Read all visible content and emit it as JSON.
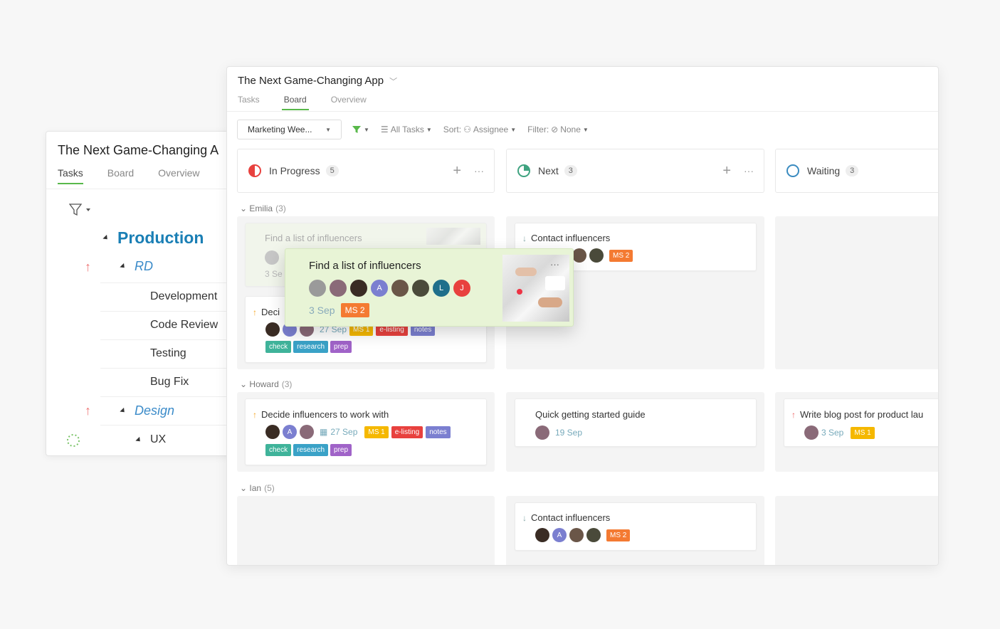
{
  "back": {
    "title": "The Next Game-Changing A",
    "tabs": [
      "Tasks",
      "Board",
      "Overview"
    ],
    "tree": {
      "production": "Production",
      "rd": "RD",
      "rd_items": [
        "Development",
        "Code Review",
        "Testing",
        "Bug Fix"
      ],
      "design": "Design",
      "ux": "UX"
    }
  },
  "front": {
    "title": "The Next Game-Changing App",
    "tabs": [
      "Tasks",
      "Board",
      "Overview"
    ],
    "toolbar": {
      "view": "Marketing Wee...",
      "all_tasks": "All Tasks",
      "sort_label": "Sort:",
      "sort_value": "Assignee",
      "filter_label": "Filter:",
      "filter_value": "None"
    },
    "columns": [
      {
        "name": "In Progress",
        "count": "5"
      },
      {
        "name": "Next",
        "count": "3"
      },
      {
        "name": "Waiting",
        "count": "3"
      }
    ],
    "lanes": [
      {
        "name": "Emilia",
        "count": "(3)"
      },
      {
        "name": "Howard",
        "count": "(3)"
      },
      {
        "name": "Ian",
        "count": "(5)"
      }
    ],
    "cards": {
      "ghost_title": "Find a list of influencers",
      "ghost_date": "3 Se",
      "decide_trunc_title": "Deci",
      "decide_trunc_date": "27 Sep",
      "contact_title": "Contact influencers",
      "contact_ms": "MS 2",
      "decide_title": "Decide influencers to work with",
      "decide_date": "27 Sep",
      "quick_title": "Quick getting started guide",
      "quick_date": "19 Sep",
      "blog_title": "Write blog post for product lau",
      "blog_date": "3 Sep",
      "blog_ms": "MS 1",
      "contact2_title": "Contact influencers",
      "contact2_ms": "MS 2"
    },
    "tags": {
      "ms1": "MS 1",
      "elisting": "e-listing",
      "notes": "notes",
      "check": "check",
      "research": "research",
      "prep": "prep"
    },
    "drag": {
      "title": "Find a list of influencers",
      "date": "3 Sep",
      "ms": "MS 2",
      "avatar_a": "A",
      "avatar_l": "L",
      "avatar_j": "J"
    },
    "avatar_a": "A"
  },
  "colors": {
    "accent_green": "#58b84a",
    "ms_orange": "#f47a32",
    "ms_yellow": "#f5b800",
    "tag_red": "#e8413e",
    "tag_purple": "#7b7fd0",
    "tag_teal": "#3fb39a",
    "tag_blue": "#3aa2c7",
    "tag_violet": "#a063c8"
  }
}
